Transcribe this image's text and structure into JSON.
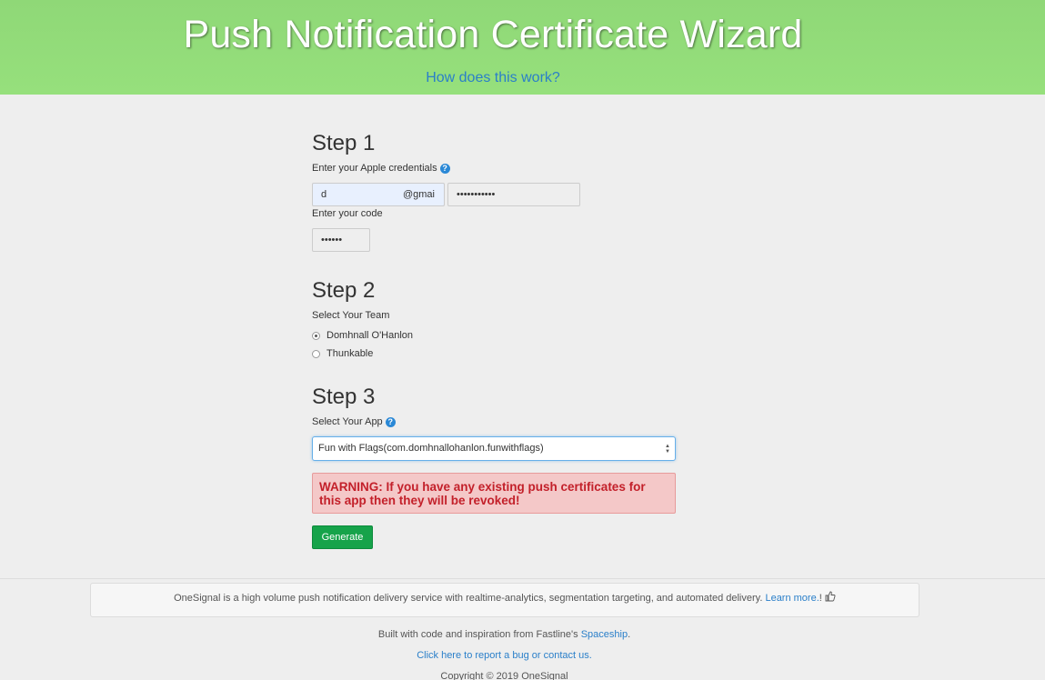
{
  "header": {
    "title": "Push Notification Certificate Wizard",
    "help_link": "How does this work?"
  },
  "step1": {
    "heading": "Step 1",
    "credentials_label": "Enter your Apple credentials",
    "email_user": "d",
    "email_domain": "@gmai",
    "password_value": "•••••••••••",
    "code_label": "Enter your code",
    "code_value": "••••••"
  },
  "step2": {
    "heading": "Step 2",
    "team_label": "Select Your Team",
    "teams": [
      {
        "label": "Domhnall O'Hanlon",
        "selected": true
      },
      {
        "label": "Thunkable",
        "selected": false
      }
    ]
  },
  "step3": {
    "heading": "Step 3",
    "app_label": "Select Your App",
    "app_selected": "Fun with Flags(com.domhnallohanlon.funwithflags)",
    "warning_line1": "WARNING: If you have any existing push certificates for",
    "warning_line2": "this app then they will be revoked!",
    "generate_label": "Generate"
  },
  "footer": {
    "info_text": "OneSignal is a high volume push notification delivery service with realtime-analytics, segmentation targeting, and automated delivery. ",
    "learn_more": "Learn more.",
    "exclaim": "!",
    "built_with": "Built with code and inspiration from Fastline's ",
    "spaceship": "Spaceship",
    "period": ".",
    "report_bug": "Click here to report a bug or contact us.",
    "copyright": "Copyright © 2019 OneSignal"
  },
  "colors": {
    "header_green": "#96e07c",
    "link_blue": "#2a7fc9",
    "button_green": "#16a34a",
    "warning_red": "#c3202a",
    "warning_bg": "#f4c8c8"
  },
  "icons": [
    "help-icon",
    "thumbs-up-icon",
    "select-arrows-icon"
  ]
}
